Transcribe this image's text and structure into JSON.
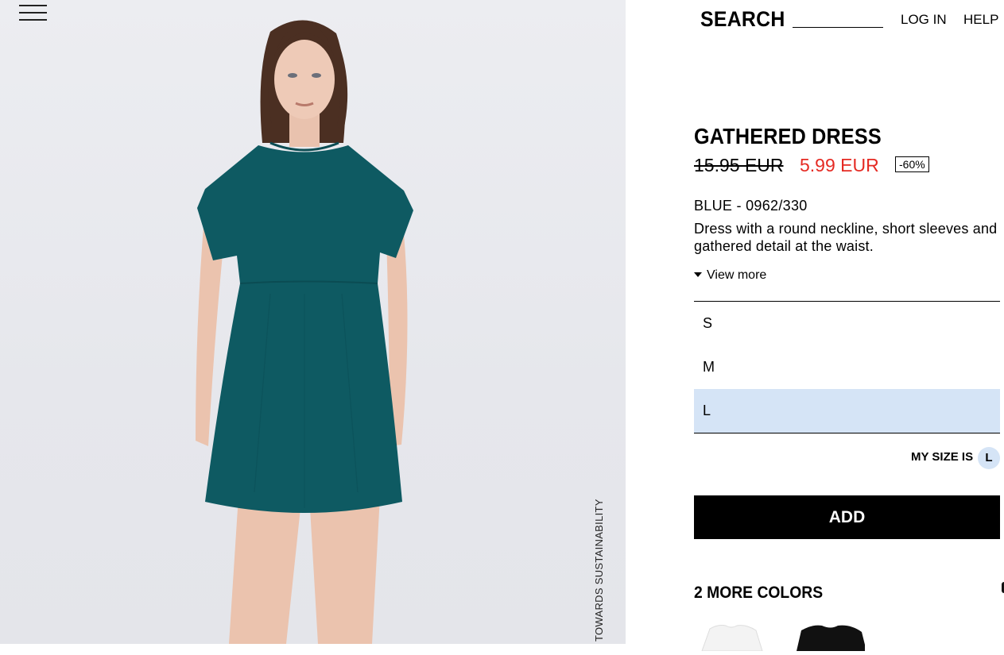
{
  "header": {
    "search_label": "SEARCH",
    "search_value": "",
    "login": "LOG IN",
    "help": "HELP"
  },
  "side": {
    "sustainability": "TOWARDS SUSTAINABILITY"
  },
  "product": {
    "title": "GATHERED DRESS",
    "old_price": "15.95 EUR",
    "new_price": "5.99 EUR",
    "discount": "-60%",
    "color_ref": "BLUE - 0962/330",
    "description": "Dress with a round neckline, short sleeves and gathered detail at the waist.",
    "view_more": "View more",
    "sizes": [
      "S",
      "M",
      "L"
    ],
    "selected_size": "L",
    "my_size_label": "MY SIZE IS",
    "my_size_value": "L",
    "add_label": "ADD",
    "more_colors": "2 MORE COLORS"
  },
  "colors": {
    "dress": "#0e5a62",
    "sale": "#e52a23",
    "selected_bg": "#d5e4f6"
  }
}
